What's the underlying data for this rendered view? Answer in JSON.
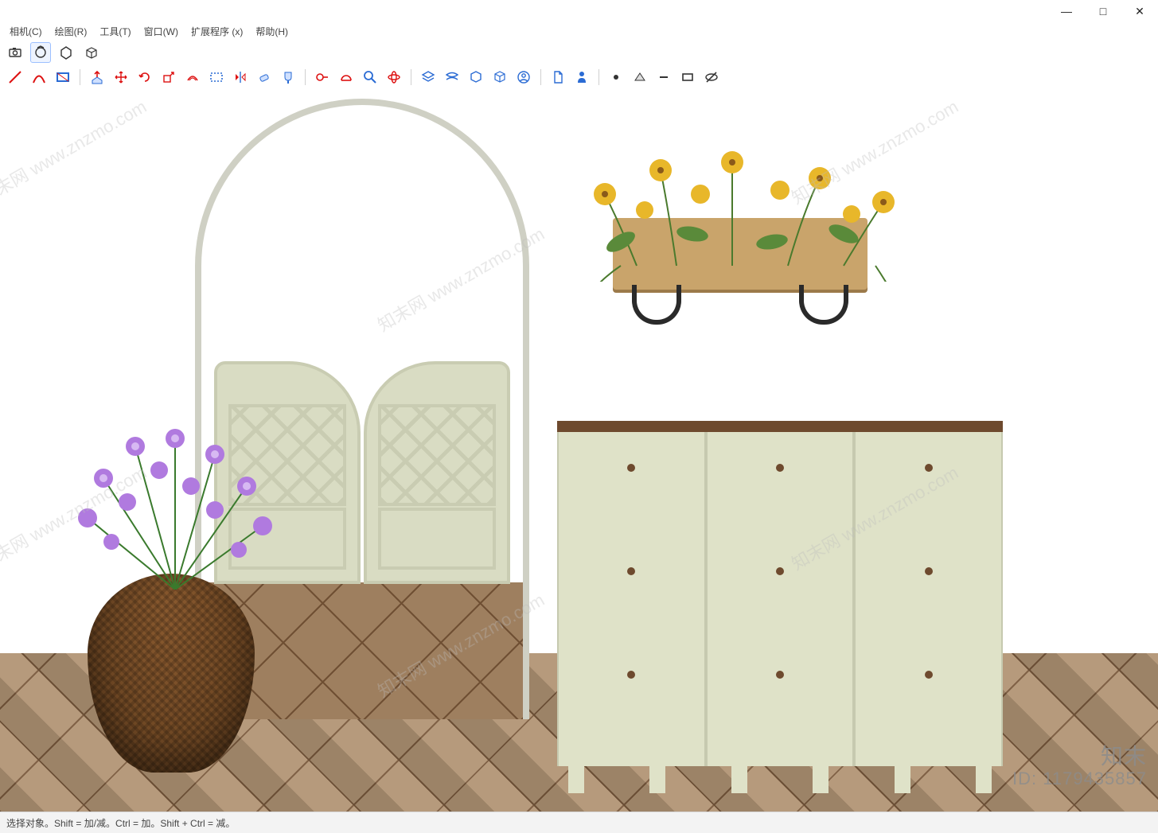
{
  "window_controls": {
    "minimize": "—",
    "maximize": "□",
    "close": "✕"
  },
  "menubar": {
    "camera": "相机(C)",
    "draw": "绘图(R)",
    "tools": "工具(T)",
    "window": "窗口(W)",
    "extensions": "扩展程序 (x)",
    "help": "帮助(H)"
  },
  "secondary_toolbar": {
    "items": [
      {
        "name": "camera-icon"
      },
      {
        "name": "orbit-icon"
      },
      {
        "name": "shape-icon"
      },
      {
        "name": "box-icon"
      }
    ]
  },
  "main_toolbar": {
    "groups": [
      {
        "items": [
          {
            "name": "line-tool",
            "color": "#d11"
          },
          {
            "name": "arc-tool",
            "color": "#d11"
          },
          {
            "name": "rectangle-tool",
            "color": "#2a6bd4"
          }
        ]
      },
      {
        "items": [
          {
            "name": "pushpull-tool",
            "color": "#2a6bd4"
          },
          {
            "name": "move-tool",
            "color": "#d11"
          },
          {
            "name": "rotate-tool",
            "color": "#d11"
          },
          {
            "name": "scale-tool",
            "color": "#d11"
          },
          {
            "name": "offset-tool",
            "color": "#d11"
          },
          {
            "name": "select-rect",
            "color": "#2a6bd4"
          },
          {
            "name": "mirror-tool",
            "color": "#d11"
          },
          {
            "name": "eraser-tool",
            "color": "#2a6bd4"
          },
          {
            "name": "paint-tool",
            "color": "#2a6bd4"
          }
        ]
      },
      {
        "items": [
          {
            "name": "tape-tool",
            "color": "#d11"
          },
          {
            "name": "protractor-tool",
            "color": "#d11"
          },
          {
            "name": "zoom-tool",
            "color": "#2a6bd4"
          },
          {
            "name": "orbit-tool",
            "color": "#d11"
          }
        ]
      },
      {
        "items": [
          {
            "name": "layers-tool",
            "color": "#2a6bd4"
          },
          {
            "name": "section-tool",
            "color": "#2a6bd4"
          },
          {
            "name": "tag-tool",
            "color": "#2a6bd4"
          },
          {
            "name": "tag-alt-tool",
            "color": "#2a6bd4"
          },
          {
            "name": "user-circle-tool",
            "color": "#2a6bd4"
          }
        ]
      },
      {
        "items": [
          {
            "name": "doc-tool",
            "color": "#2a6bd4"
          },
          {
            "name": "person-tool",
            "color": "#2a6bd4"
          }
        ]
      },
      {
        "items": [
          {
            "name": "dot-tool",
            "color": "#333"
          },
          {
            "name": "short-line-tool",
            "color": "#333"
          },
          {
            "name": "long-line-tool",
            "color": "#333"
          },
          {
            "name": "rect-outline-tool",
            "color": "#333"
          },
          {
            "name": "hidden-tool",
            "color": "#333"
          }
        ]
      }
    ]
  },
  "statusbar": {
    "text": "选择对象。Shift = 加/减。Ctrl = 加。Shift + Ctrl = 减。"
  },
  "watermark": {
    "brand": "知末",
    "id_label": "ID:",
    "id_value": "1179435857",
    "diag_text": "知末网 www.znzmo.com"
  },
  "scene": {
    "arch_label": "arched-doorway",
    "gate_label": "lattice-swing-gate",
    "basket_label": "wicker-basket-planter",
    "purple_flowers_label": "purple-flowers",
    "cabinet_label": "three-door-cabinet",
    "shelf_label": "wall-planter-shelf",
    "yellow_flowers_label": "yellow-flowers"
  }
}
